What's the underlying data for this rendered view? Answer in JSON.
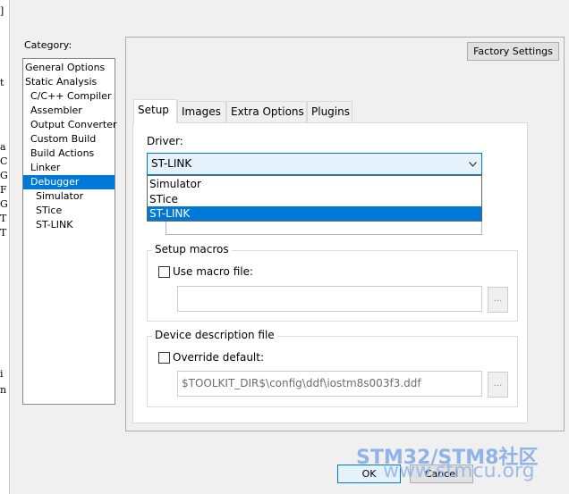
{
  "background_strip": {
    "fragments": [
      "]",
      "t",
      "a",
      "C",
      "G",
      "F",
      "G",
      "T",
      "T",
      "i",
      "n"
    ]
  },
  "category": {
    "label": "Category:",
    "items": [
      {
        "label": "General Options",
        "indent": 0,
        "selected": false
      },
      {
        "label": "Static Analysis",
        "indent": 0,
        "selected": false
      },
      {
        "label": "C/C++ Compiler",
        "indent": 1,
        "selected": false
      },
      {
        "label": "Assembler",
        "indent": 1,
        "selected": false
      },
      {
        "label": "Output Converter",
        "indent": 1,
        "selected": false
      },
      {
        "label": "Custom Build",
        "indent": 1,
        "selected": false
      },
      {
        "label": "Build Actions",
        "indent": 1,
        "selected": false
      },
      {
        "label": "Linker",
        "indent": 1,
        "selected": false
      },
      {
        "label": "Debugger",
        "indent": 1,
        "selected": true
      },
      {
        "label": "Simulator",
        "indent": 2,
        "selected": false
      },
      {
        "label": "STice",
        "indent": 2,
        "selected": false
      },
      {
        "label": "ST-LINK",
        "indent": 2,
        "selected": false
      }
    ]
  },
  "factory_settings_label": "Factory Settings",
  "tabs": [
    {
      "label": "Setup",
      "active": true
    },
    {
      "label": "Images",
      "active": false
    },
    {
      "label": "Extra Options",
      "active": false
    },
    {
      "label": "Plugins",
      "active": false
    }
  ],
  "driver": {
    "label": "Driver:",
    "selected": "ST-LINK",
    "options": [
      {
        "label": "Simulator",
        "highlighted": false
      },
      {
        "label": "STice",
        "highlighted": false
      },
      {
        "label": "ST-LINK",
        "highlighted": true
      }
    ]
  },
  "setup_macros": {
    "title": "Setup macros",
    "checkbox_label": "Use macro file:",
    "checked": false,
    "value": "",
    "browse_label": "..."
  },
  "device_description": {
    "title": "Device description file",
    "checkbox_label": "Override default:",
    "checked": false,
    "value": "$TOOLKIT_DIR$\\config\\ddf\\iostm8s003f3.ddf",
    "browse_label": "..."
  },
  "buttons": {
    "ok": "OK",
    "cancel": "Cancel"
  },
  "watermark": {
    "line1_part1": "STM32/",
    "line1_part2": "STM8",
    "line1_part3": "社区",
    "line2": "www.stmcu.org",
    "color_blue": "#2a6fd0",
    "color_light": "#8fb4e6"
  }
}
